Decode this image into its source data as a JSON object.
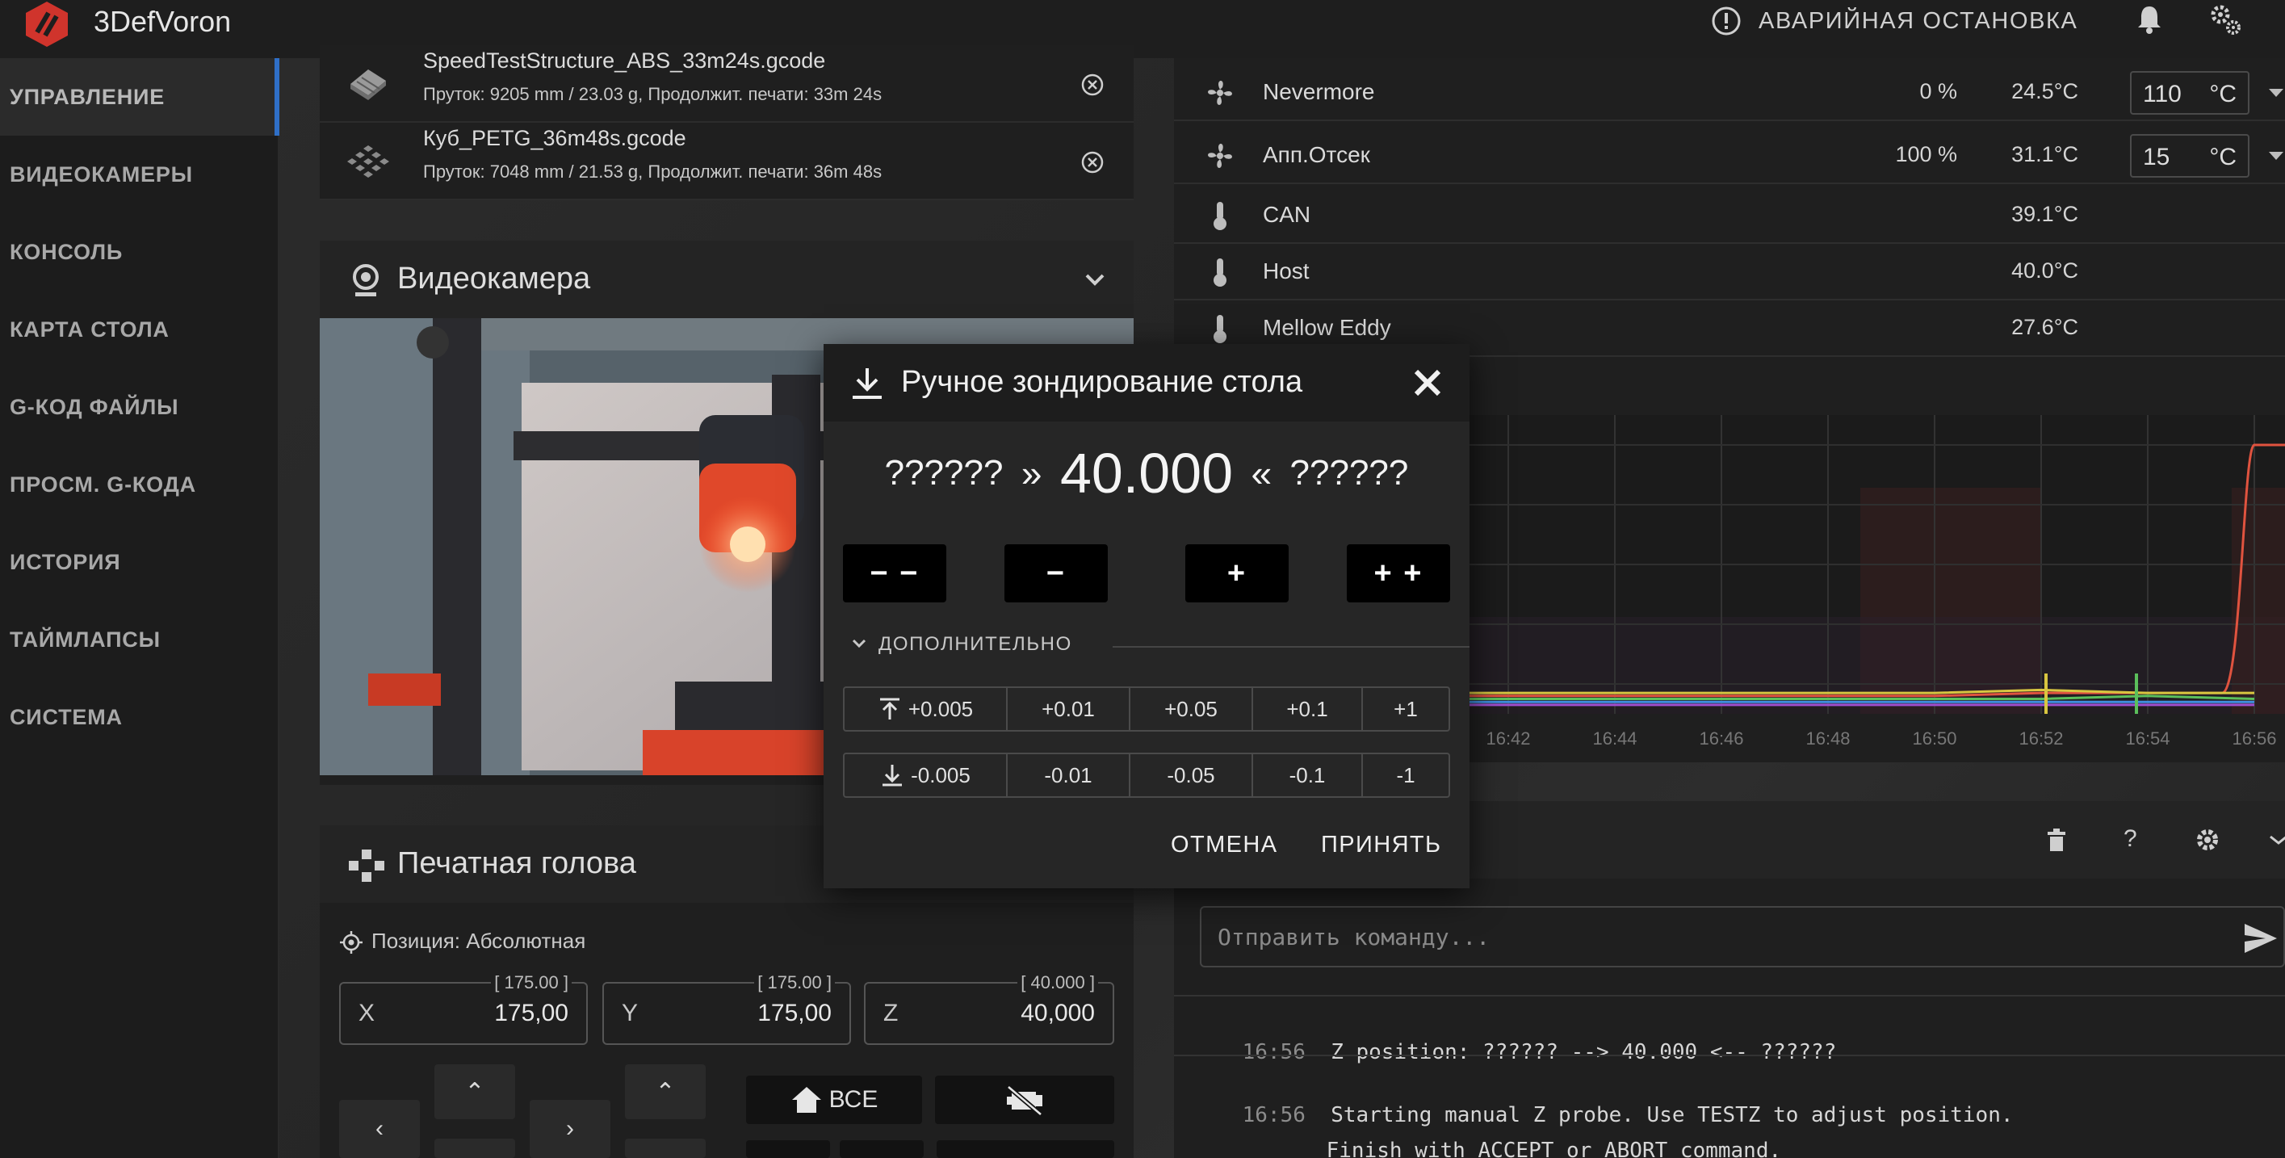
{
  "app": {
    "title": "3DefVoron",
    "estop_label": "АВАРИЙНАЯ ОСТАНОВКА"
  },
  "sidebar": {
    "items": [
      {
        "label": "УПРАВЛЕНИЕ"
      },
      {
        "label": "ВИДЕОКАМЕРЫ"
      },
      {
        "label": "КОНСОЛЬ"
      },
      {
        "label": "КАРТА СТОЛА"
      },
      {
        "label": "G-КОД ФАЙЛЫ"
      },
      {
        "label": "ПРОСМ. G-КОДА"
      },
      {
        "label": "ИСТОРИЯ"
      },
      {
        "label": "ТАЙМЛАПСЫ"
      },
      {
        "label": "СИСТЕМА"
      }
    ]
  },
  "files": [
    {
      "name": "SpeedTestStructure_ABS_33m24s.gcode",
      "meta": "Пруток: 9205 mm / 23.03 g, Продолжит. печати: 33m 24s"
    },
    {
      "name": "Куб_PETG_36m48s.gcode",
      "meta": "Пруток: 7048 mm / 21.53 g, Продолжит. печати: 36m 48s"
    }
  ],
  "camera": {
    "title": "Видеокамера"
  },
  "toolhead": {
    "title": "Печатная голова",
    "position_label": "Позиция: Абсолютная",
    "axes": [
      {
        "name": "X",
        "value": "175,00",
        "limit": "[ 175.00 ]"
      },
      {
        "name": "Y",
        "value": "175,00",
        "limit": "[ 175.00 ]"
      },
      {
        "name": "Z",
        "value": "40,000",
        "limit": "[ 40.000 ]"
      }
    ],
    "home_all_label": "ВСЕ"
  },
  "sensors": [
    {
      "name": "Nevermore",
      "power": "0 %",
      "temp": "24.5°C",
      "target": "110",
      "unit": "°C",
      "icon": "fan-icon"
    },
    {
      "name": "Апп.Отсек",
      "power": "100 %",
      "temp": "31.1°C",
      "target": "15",
      "unit": "°C",
      "icon": "fan-icon"
    },
    {
      "name": "CAN",
      "power": "",
      "temp": "39.1°C",
      "icon": "thermometer-icon"
    },
    {
      "name": "Host",
      "power": "",
      "temp": "40.0°C",
      "icon": "thermometer-icon"
    },
    {
      "name": "Mellow Eddy",
      "power": "",
      "temp": "27.6°C",
      "icon": "thermometer-icon"
    }
  ],
  "chart_data": {
    "type": "line",
    "x": [
      "16:42",
      "16:44",
      "16:46",
      "16:48",
      "16:50",
      "16:52",
      "16:54",
      "16:56"
    ],
    "series": [
      {
        "values": [
          26,
          26,
          26,
          26,
          26,
          27,
          27,
          110
        ],
        "color": "#e0533f"
      },
      {
        "values": [
          27,
          27,
          27,
          27,
          27,
          28,
          27,
          27
        ],
        "color": "#d8c640"
      },
      {
        "values": [
          25,
          25,
          25,
          25,
          25,
          25,
          26,
          25
        ],
        "color": "#5bbf5b"
      },
      {
        "values": [
          24,
          24,
          24,
          24,
          24,
          24,
          24,
          24
        ],
        "color": "#3f8fe0"
      },
      {
        "values": [
          23,
          23,
          23,
          23,
          23,
          23,
          23,
          23
        ],
        "color": "#a04fcf"
      }
    ]
  },
  "console": {
    "placeholder": "Отправить команду...",
    "lines": [
      {
        "time": "16:56",
        "text": "Z position: ?????? --> 40.000 <-- ??????"
      },
      {
        "time": "16:56",
        "text": "Starting manual Z probe. Use TESTZ to adjust position."
      },
      {
        "time": "",
        "text": "Finish with ACCEPT or ABORT command."
      }
    ]
  },
  "dialog": {
    "title": "Ручное зондирование стола",
    "left_marker": "??????",
    "left_arrow": "»",
    "z_value": "40.000",
    "right_arrow": "«",
    "right_marker": "??????",
    "step_buttons": [
      "− −",
      "−",
      "+",
      "+ +"
    ],
    "advanced_label": "ДОПОЛНИТЕЛЬНО",
    "raise": [
      "+0.005",
      "+0.01",
      "+0.05",
      "+0.1",
      "+1"
    ],
    "lower": [
      "-0.005",
      "-0.01",
      "-0.05",
      "-0.1",
      "-1"
    ],
    "cancel_label": "ОТМЕНА",
    "accept_label": "ПРИНЯТЬ"
  }
}
